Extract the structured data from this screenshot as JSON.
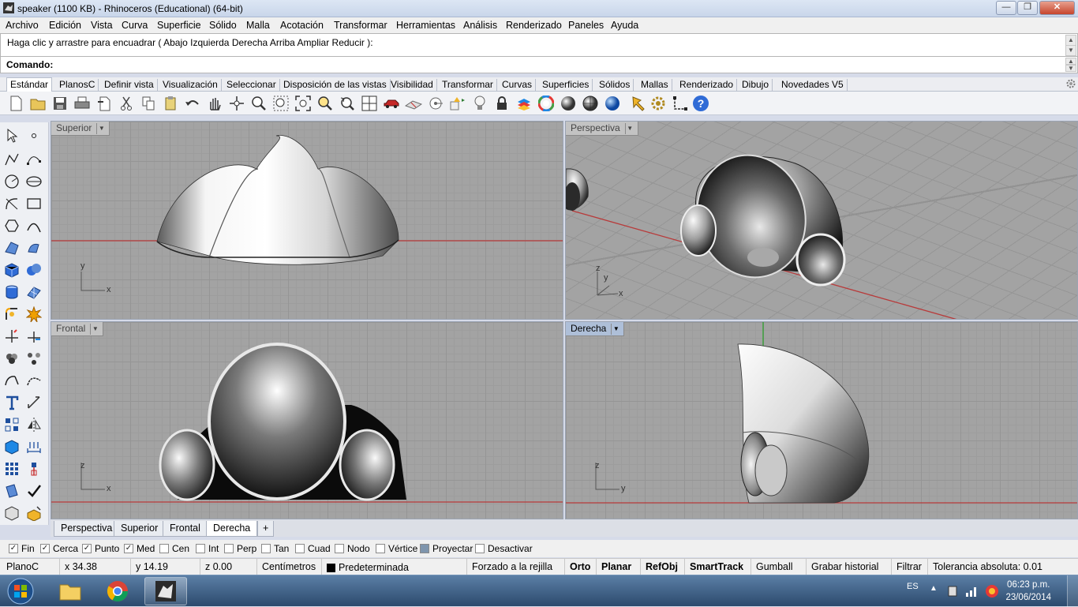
{
  "window": {
    "title": "speaker (1100 KB) - Rhinoceros (Educational) (64-bit)",
    "minimize_label": "—",
    "restore_label": "❐",
    "close_label": "✕"
  },
  "menu": [
    "Archivo",
    "Edición",
    "Vista",
    "Curva",
    "Superficie",
    "Sólido",
    "Malla",
    "Acotación",
    "Transformar",
    "Herramientas",
    "Análisis",
    "Renderizado",
    "Paneles",
    "Ayuda"
  ],
  "command": {
    "history_text": "Haga clic y arrastre para encuadrar ( Abajo  Izquierda  Derecha  Arriba  Ampliar  Reducir ):",
    "prompt_label": "Comando:",
    "input_value": ""
  },
  "toolbar_tabs": [
    "Estándar",
    "PlanosC",
    "Definir vista",
    "Visualización",
    "Seleccionar",
    "Disposición de las vistas",
    "Visibilidad",
    "Transformar",
    "Curvas",
    "Superficies",
    "Sólidos",
    "Mallas",
    "Renderizado",
    "Dibujo",
    "Novedades V5"
  ],
  "active_toolbar_tab": "Estándar",
  "viewports": {
    "superior": {
      "label": "Superior",
      "axis1": "y",
      "axis2": "x"
    },
    "perspectiva": {
      "label": "Perspectiva",
      "axis1": "z",
      "axis2": "y",
      "axis3": "x"
    },
    "frontal": {
      "label": "Frontal",
      "axis1": "z",
      "axis2": "x"
    },
    "derecha": {
      "label": "Derecha",
      "axis1": "z",
      "axis2": "y"
    }
  },
  "viewport_tabs": [
    "Perspectiva",
    "Superior",
    "Frontal",
    "Derecha"
  ],
  "active_viewport_tab": "Derecha",
  "add_viewport_label": "+",
  "osnaps": [
    {
      "label": "Fin",
      "checked": true
    },
    {
      "label": "Cerca",
      "checked": true
    },
    {
      "label": "Punto",
      "checked": true
    },
    {
      "label": "Med",
      "checked": true
    },
    {
      "label": "Cen",
      "checked": false
    },
    {
      "label": "Int",
      "checked": false
    },
    {
      "label": "Perp",
      "checked": false
    },
    {
      "label": "Tan",
      "checked": false
    },
    {
      "label": "Cuad",
      "checked": false
    },
    {
      "label": "Nodo",
      "checked": false
    },
    {
      "label": "Vértice",
      "checked": false
    },
    {
      "label": "Proyectar",
      "checked": false
    },
    {
      "label": "Desactivar",
      "checked": false
    }
  ],
  "status": {
    "cplane": "PlanoC",
    "x": "x 34.38",
    "y": "y 14.19",
    "z": "z 0.00",
    "units": "Centímetros",
    "layer": "Predeterminada",
    "grid_snap": "Forzado a la rejilla",
    "ortho": "Orto",
    "planar": "Planar",
    "osnap": "RefObj",
    "smarttrack": "SmartTrack",
    "gumball": "Gumball",
    "record_history": "Grabar historial",
    "filter": "Filtrar",
    "tolerance": "Tolerancia absoluta: 0.01"
  },
  "taskbar": {
    "language": "ES",
    "time": "06:23 p.m.",
    "date": "23/06/2014"
  },
  "colors": {
    "viewport_bg": "#a3a3a3",
    "x_axis": "#b83a3a",
    "y_axis": "#2fa12f",
    "active_viewport_label": "#aebfd8"
  }
}
